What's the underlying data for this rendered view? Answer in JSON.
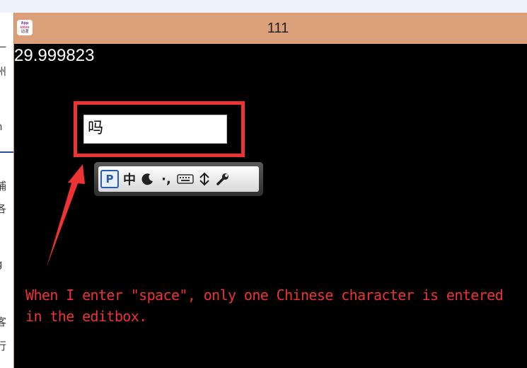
{
  "window": {
    "title": "111",
    "app_icon": {
      "icon": "app-icon",
      "lines": [
        "App",
        "store",
        "动漫"
      ]
    }
  },
  "fps_counter": "29.999823",
  "editbox": {
    "value": "吗"
  },
  "ime_toolbar": {
    "items": [
      {
        "name": "ime-logo-icon",
        "label": "P"
      },
      {
        "name": "chinese-mode-toggle",
        "label": "中"
      },
      {
        "name": "half-width-moon-icon",
        "label": ""
      },
      {
        "name": "punctuation-toggle",
        "label": "·,"
      },
      {
        "name": "soft-keyboard-icon",
        "label": ""
      },
      {
        "name": "simplified-traditional-icon",
        "label": ""
      },
      {
        "name": "settings-wrench-icon",
        "label": ""
      }
    ]
  },
  "annotation": {
    "line1": "When I enter \"space\", only one Chinese character is entered",
    "line2": "in the editbox.",
    "color": "#ee3333"
  },
  "background_fragments": [
    "一",
    "州",
    "n",
    "捕",
    "各",
    "g",
    "客",
    "行"
  ]
}
